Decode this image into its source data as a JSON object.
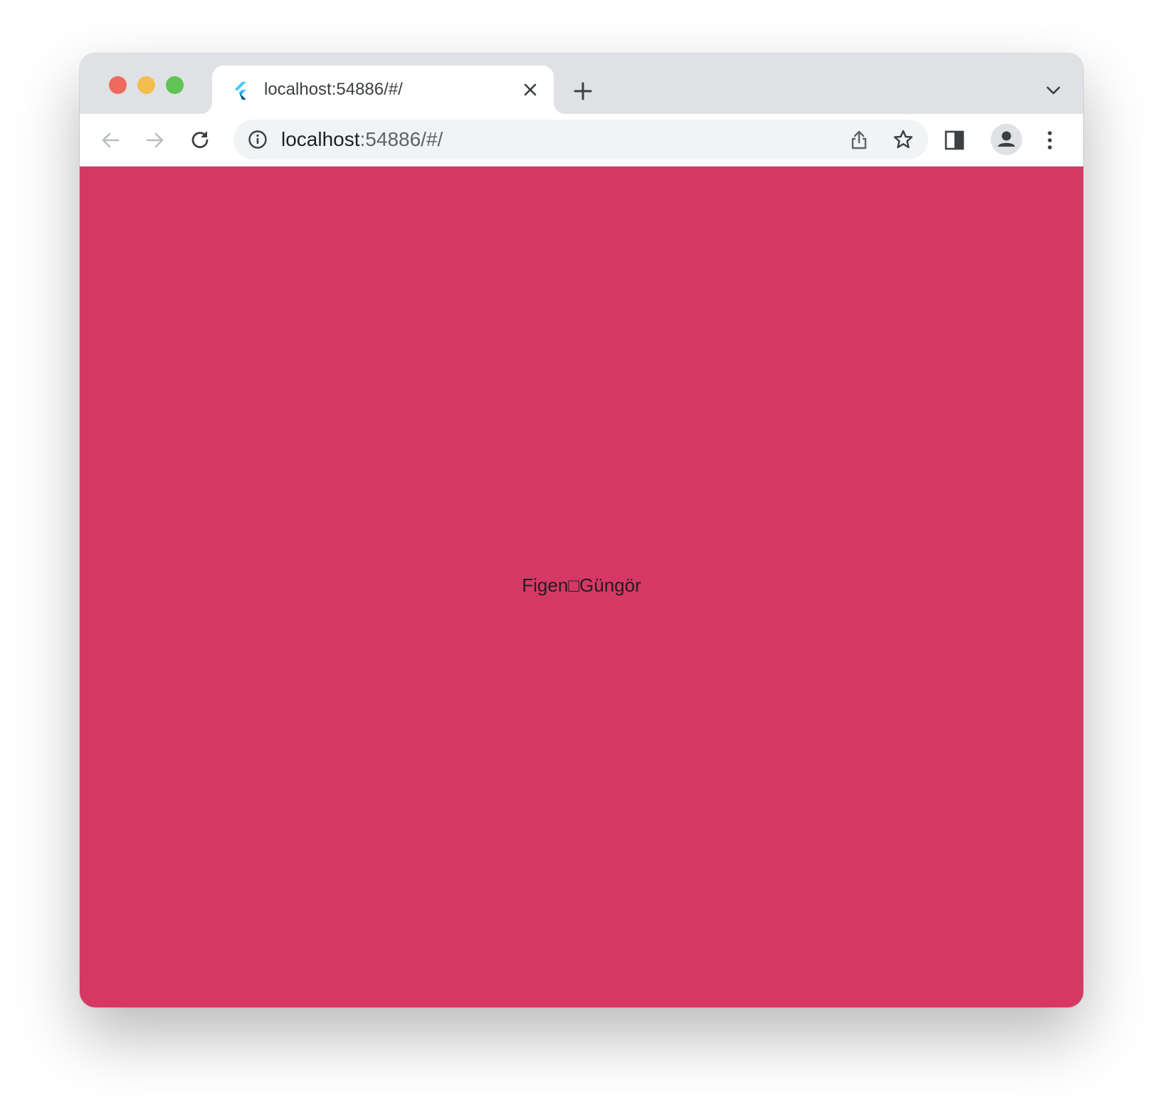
{
  "colors": {
    "page_background": "#d63864",
    "close": "#ee6a5f",
    "minimize": "#f5bd4f",
    "maximize": "#61c454",
    "icon": "#5f6368",
    "icon_disabled": "#b8bbbf"
  },
  "tab": {
    "favicon": "flutter-icon",
    "title": "localhost:54886/#/"
  },
  "omnibox": {
    "host": "localhost",
    "rest": ":54886/#/"
  },
  "icons": {
    "back": "back-arrow-icon",
    "forward": "forward-arrow-icon",
    "reload": "reload-icon",
    "info": "info-icon",
    "share": "share-icon",
    "bookmark": "star-icon",
    "side_panel": "side-panel-icon",
    "profile": "profile-icon",
    "menu": "kebab-menu-icon",
    "tab_search": "chevron-down-icon",
    "new_tab": "plus-icon",
    "tab_close": "close-icon"
  },
  "page": {
    "text": "Figen□Güngör"
  }
}
